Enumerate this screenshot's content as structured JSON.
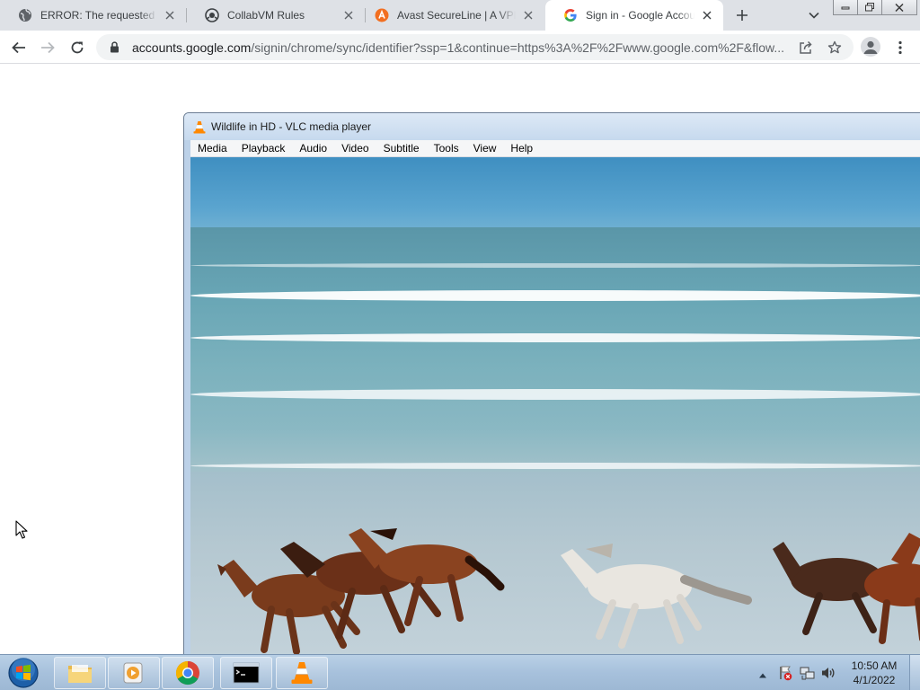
{
  "browser": {
    "tabs": [
      {
        "title": "ERROR: The requested URL could not be retrieved",
        "favicon": "globe-icon"
      },
      {
        "title": "CollabVM Rules",
        "favicon": "collabvm-icon"
      },
      {
        "title": "Avast SecureLine | A VPN",
        "favicon": "avast-icon"
      },
      {
        "title": "Sign in - Google Accounts",
        "favicon": "google-icon",
        "active": true
      }
    ],
    "url_host": "accounts.google.com",
    "url_path": "/signin/chrome/sync/identifier?ssp=1&continue=https%3A%2F%2Fwww.google.com%2F&flow..."
  },
  "vlc": {
    "window_title": "Wildlife in HD - VLC media player",
    "menu": [
      "Media",
      "Playback",
      "Audio",
      "Video",
      "Subtitle",
      "Tools",
      "View",
      "Help"
    ]
  },
  "taskbar": {
    "apps": [
      "explorer-icon",
      "media-player-icon",
      "chrome-icon",
      "cmd-icon",
      "vlc-icon"
    ],
    "clock_time": "10:50 AM",
    "clock_date": "4/1/2022"
  },
  "colors": {
    "chrome_tabstrip": "#dee1e6",
    "omnibox": "#f1f3f4",
    "vlc_orange": "#ff8800",
    "taskbar": "#a7c1dc"
  }
}
